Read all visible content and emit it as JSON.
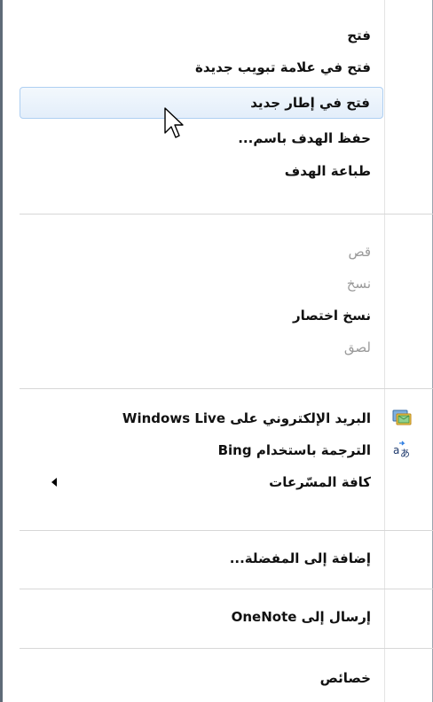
{
  "menu": {
    "items": [
      {
        "label": "فتح",
        "enabled": true
      },
      {
        "label": "فتح في علامة تبويب جديدة",
        "enabled": true
      },
      {
        "label": "فتح في إطار جديد",
        "enabled": true,
        "highlighted": true
      },
      {
        "label": "حفظ الهدف باسم...",
        "enabled": true
      },
      {
        "label": "طباعة الهدف",
        "enabled": true
      },
      {
        "label": "قص",
        "enabled": false
      },
      {
        "label": "نسخ",
        "enabled": false
      },
      {
        "label": "نسخ اختصار",
        "enabled": true
      },
      {
        "label": "لصق",
        "enabled": false
      },
      {
        "label": "البريد الإلكتروني على Windows Live",
        "enabled": true,
        "icon": "windows-live-mail-icon"
      },
      {
        "label": "الترجمة باستخدام Bing",
        "enabled": true,
        "icon": "translate-icon"
      },
      {
        "label": "كافة المسّرعات",
        "enabled": true,
        "submenu": true
      },
      {
        "label": "إضافة إلى المفضلة...",
        "enabled": true
      },
      {
        "label": "إرسال إلى OneNote",
        "enabled": true
      },
      {
        "label": "خصائص",
        "enabled": true
      }
    ]
  },
  "colors": {
    "highlight_border": "#aecff2",
    "highlight_fill": "#e3eefa",
    "disabled_text": "#9a9a9a",
    "separator": "#d7d7d7"
  }
}
